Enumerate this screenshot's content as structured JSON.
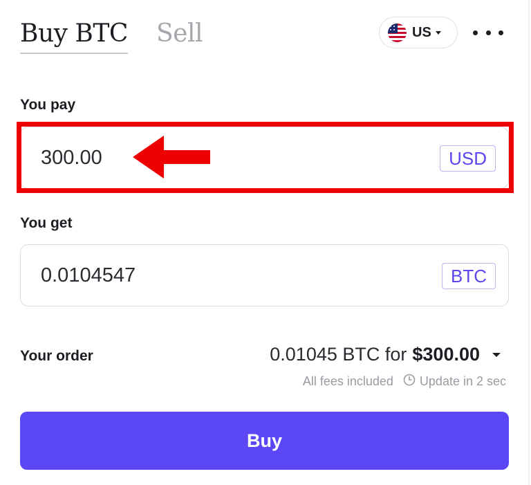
{
  "tabs": {
    "buy_label": "Buy BTC",
    "sell_label": "Sell"
  },
  "region": {
    "label": "US",
    "flag_icon": "us-flag-icon"
  },
  "menu": {
    "icon": "more-horizontal-icon"
  },
  "pay": {
    "label": "You pay",
    "value": "300.00",
    "currency": "USD"
  },
  "get": {
    "label": "You get",
    "value": "0.0104547",
    "currency": "BTC"
  },
  "order": {
    "label": "Your order",
    "summary": "0.01045 BTC for",
    "amount": "$300.00",
    "fees_note": "All fees included",
    "update_note": "Update in 2 sec",
    "clock_icon": "clock-icon"
  },
  "buy_button_label": "Buy",
  "colors": {
    "accent": "#5b47f5",
    "annotation": "#ee0000"
  }
}
